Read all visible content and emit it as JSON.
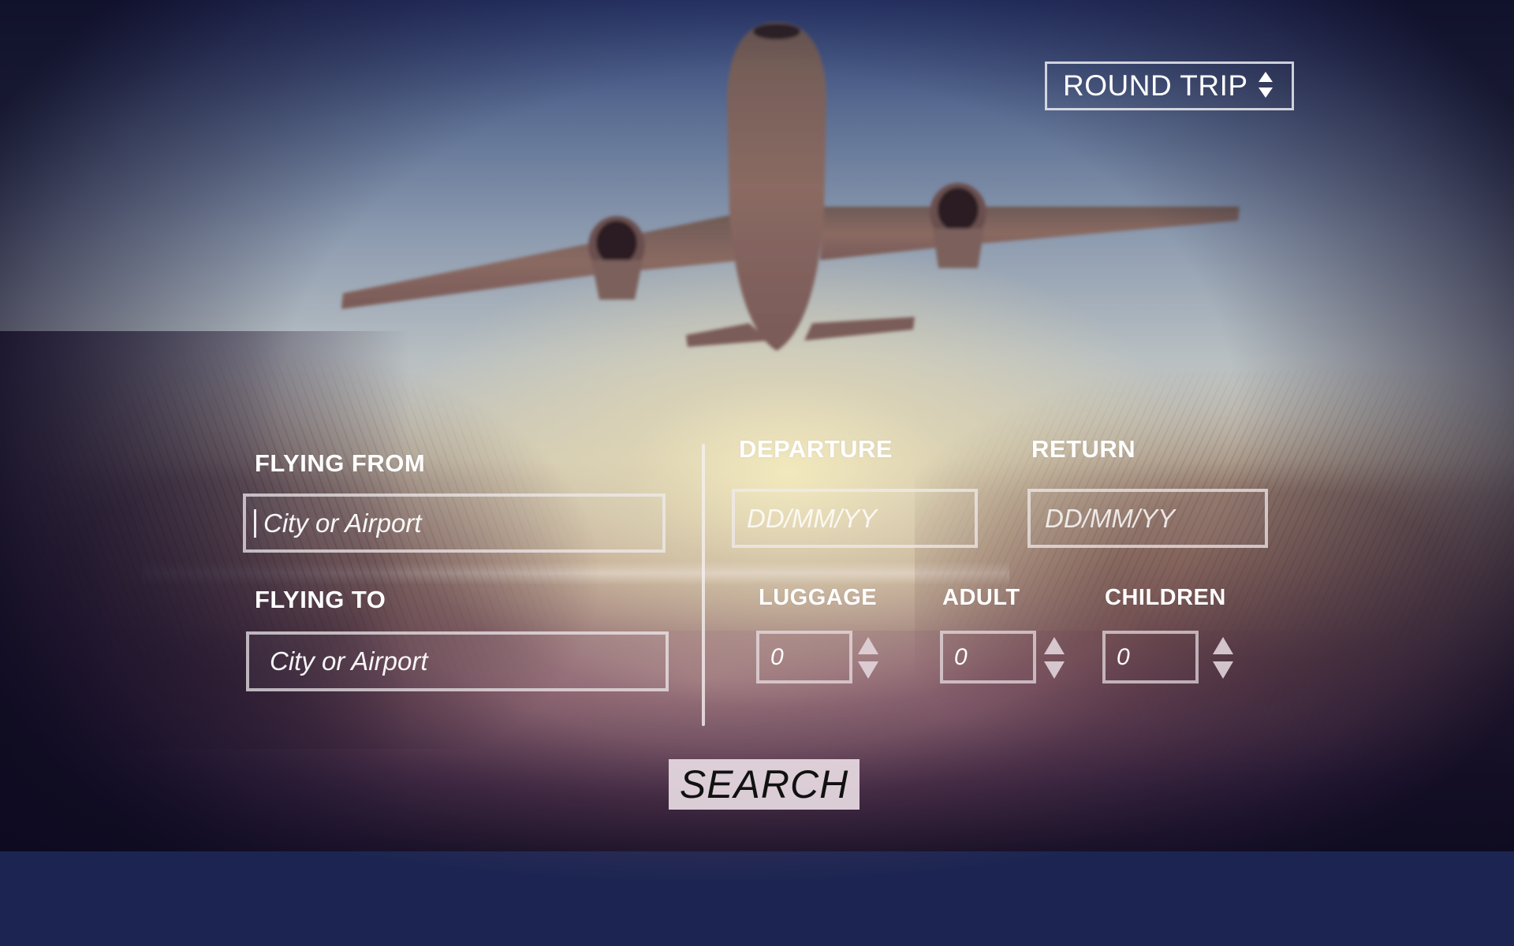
{
  "trip_type": {
    "selected": "ROUND TRIP",
    "icon": "updown-arrows-icon"
  },
  "flying_from": {
    "label": "FLYING FROM",
    "placeholder": "City or Airport",
    "value": ""
  },
  "flying_to": {
    "label": "FLYING TO",
    "placeholder": "City or Airport",
    "value": ""
  },
  "departure": {
    "label": "DEPARTURE",
    "placeholder": "DD/MM/YY"
  },
  "return": {
    "label": "RETURN",
    "placeholder": "DD/MM/YY"
  },
  "luggage": {
    "label": "LUGGAGE",
    "value": "0"
  },
  "adult": {
    "label": "ADULT",
    "value": "0"
  },
  "children": {
    "label": "CHILDREN",
    "value": "0"
  },
  "search": {
    "label": "SEARCH"
  },
  "colors": {
    "form_border": "#f0ebee",
    "label_text": "#ffffff",
    "search_bg": "#e4d6de",
    "search_text": "#111111"
  }
}
